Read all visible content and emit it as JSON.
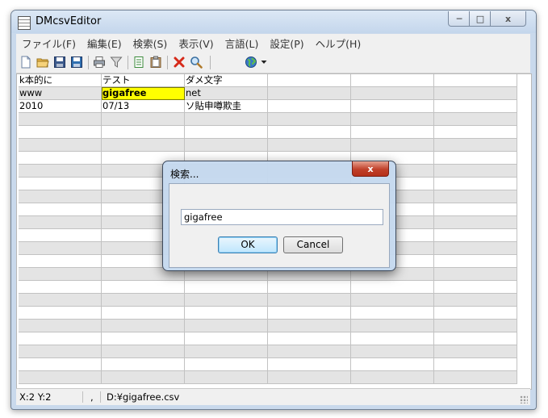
{
  "window": {
    "title": "DMcsvEditor",
    "icon": "app-grid-icon"
  },
  "menu": [
    "ファイル(F)",
    "編集(E)",
    "検索(S)",
    "表示(V)",
    "言語(L)",
    "設定(P)",
    "ヘルプ(H)"
  ],
  "toolbar": {
    "icons": [
      "new-file-icon",
      "open-folder-icon",
      "save-icon",
      "save-as-icon",
      "print-icon",
      "filter-icon",
      "copy-icon",
      "paste-icon",
      "delete-icon",
      "search-icon",
      "globe-icon",
      "dropdown-arrow-icon"
    ]
  },
  "grid": {
    "rows": [
      [
        "k本的に",
        "テスト",
        "ダメ文字",
        "",
        "",
        "",
        ""
      ],
      [
        "www",
        "gigafree",
        "net",
        "",
        "",
        "",
        ""
      ],
      [
        "2010",
        "07/13",
        "ソ貼申噂欺圭",
        "",
        "",
        "",
        ""
      ]
    ],
    "selected_cell": "gigafree"
  },
  "status": {
    "coords": "X:2  Y:2",
    "separator": ",",
    "file": "D:¥gigafree.csv"
  },
  "dialog": {
    "title": "検索...",
    "close_label": "x",
    "input_value": "gigafree",
    "ok_label": "OK",
    "cancel_label": "Cancel"
  },
  "colors": {
    "selection": "#ffff00",
    "frame": "#c9d9ec"
  }
}
